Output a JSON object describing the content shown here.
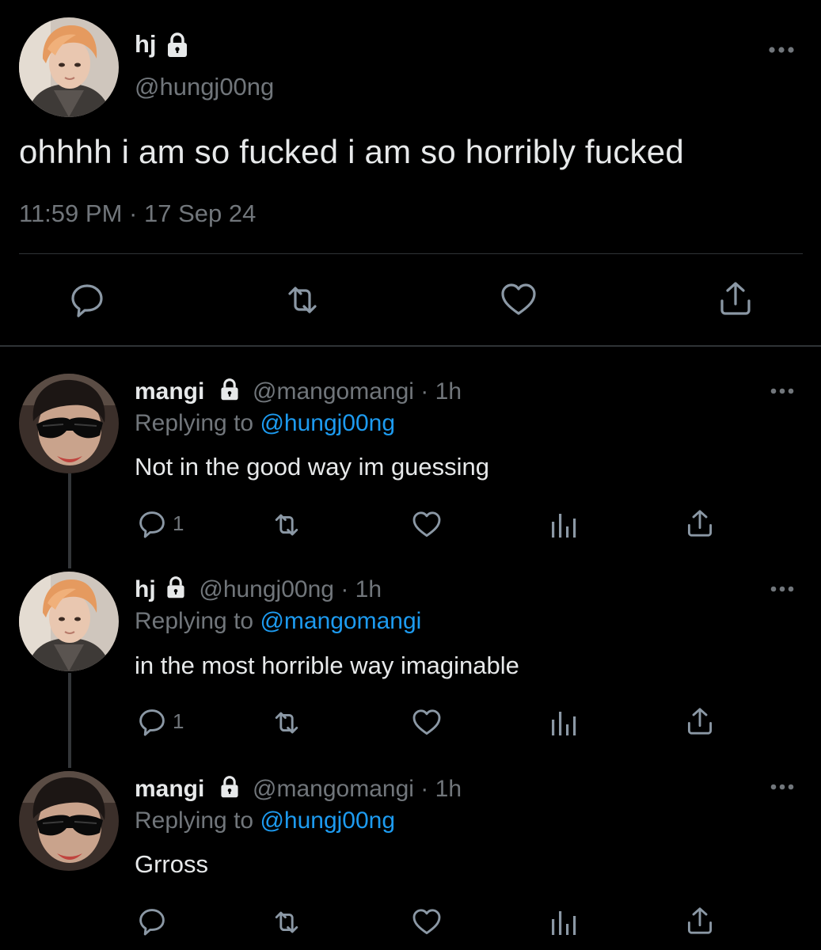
{
  "main_tweet": {
    "display_name": "hj",
    "handle": "@hungj00ng",
    "text": "ohhhh i am so fucked i am so horribly fucked",
    "time": "11:59 PM",
    "separator": "·",
    "date": "17 Sep 24",
    "avatar_icon": "avatar-photo-orange-hair"
  },
  "replies": [
    {
      "display_name": "mangi",
      "handle": "@mangomangi",
      "age": "1h",
      "replying_prefix": "Replying to",
      "replying_to": "@hungj00ng",
      "text": "Not in the good way im guessing",
      "reply_count": "1",
      "avatar_icon": "avatar-photo-sunglasses"
    },
    {
      "display_name": "hj",
      "handle": "@hungj00ng",
      "age": "1h",
      "replying_prefix": "Replying to",
      "replying_to": "@mangomangi",
      "text": "in the most horrible way imaginable",
      "reply_count": "1",
      "avatar_icon": "avatar-photo-orange-hair"
    },
    {
      "display_name": "mangi",
      "handle": "@mangomangi",
      "age": "1h",
      "replying_prefix": "Replying to",
      "replying_to": "@hungj00ng",
      "text": "Grross",
      "reply_count": "",
      "avatar_icon": "avatar-photo-sunglasses"
    }
  ],
  "colors": {
    "background": "#000000",
    "text_primary": "#e7e9ea",
    "text_secondary": "#71767b",
    "accent_link": "#1d9bf0",
    "divider": "#2f3336"
  }
}
